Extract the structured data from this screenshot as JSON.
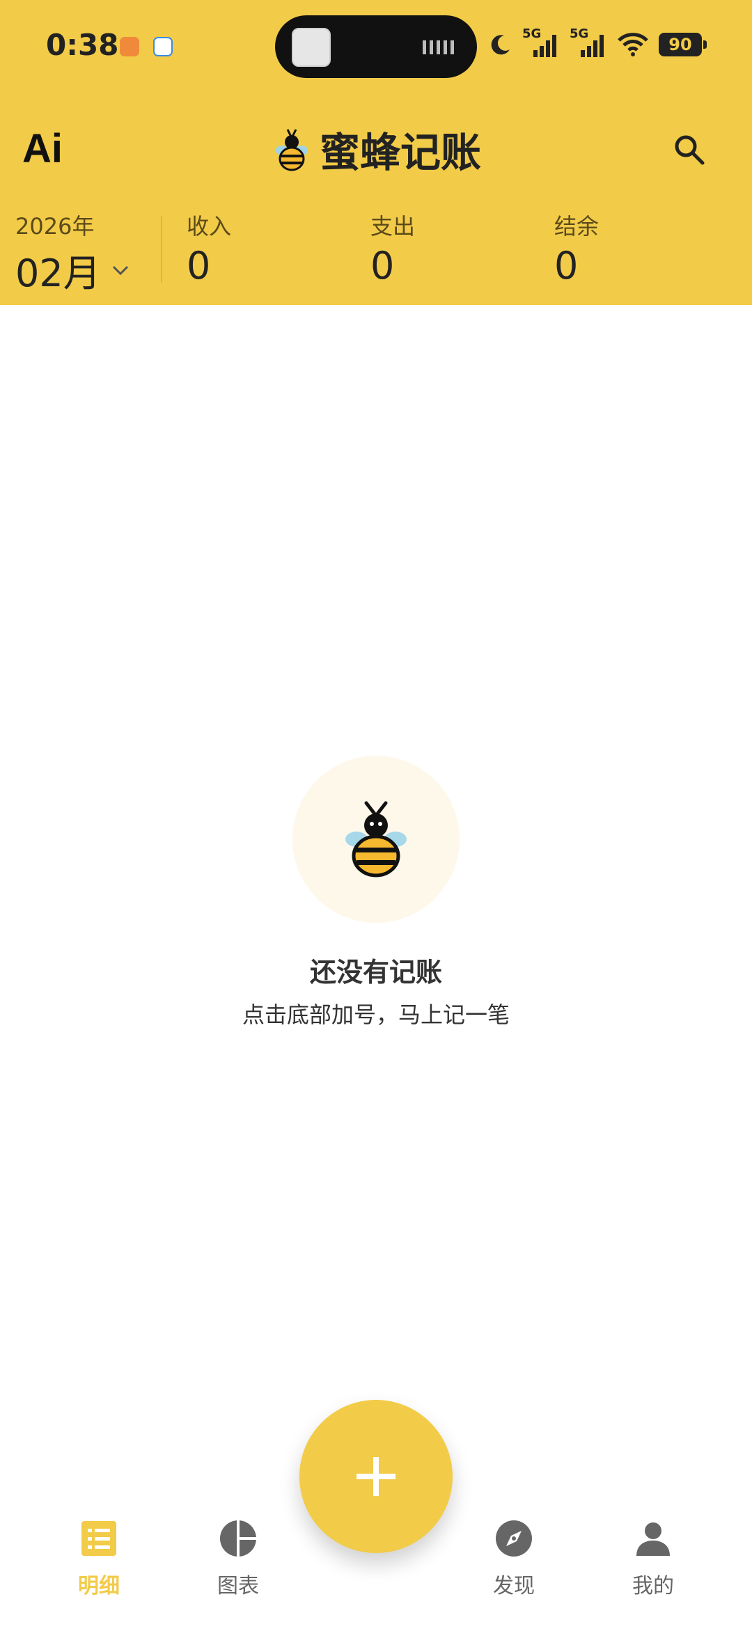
{
  "status_bar": {
    "time": "0:38",
    "battery": "90",
    "signal_labels": [
      "5G",
      "5G"
    ]
  },
  "app_bar": {
    "ai_label": "Ai",
    "title": "蜜蜂记账"
  },
  "summary": {
    "year": "2026年",
    "month": "02月",
    "income_label": "收入",
    "income_value": "0",
    "expense_label": "支出",
    "expense_value": "0",
    "balance_label": "结余",
    "balance_value": "0"
  },
  "empty_state": {
    "title": "还没有记账",
    "subtitle": "点击底部加号，马上记一笔"
  },
  "nav": {
    "items": [
      {
        "label": "明细",
        "icon": "list-icon",
        "active": true
      },
      {
        "label": "图表",
        "icon": "pie-chart-icon",
        "active": false
      },
      {
        "label": "发现",
        "icon": "compass-icon",
        "active": false
      },
      {
        "label": "我的",
        "icon": "person-icon",
        "active": false
      }
    ]
  },
  "colors": {
    "accent": "#F2CB48",
    "empty_bg": "#FDF8E9"
  }
}
